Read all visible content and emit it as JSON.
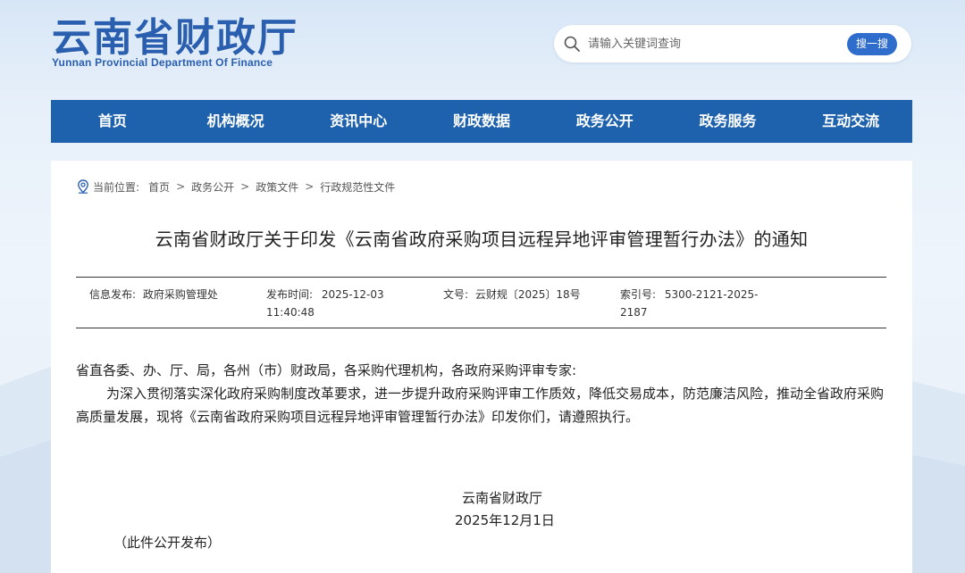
{
  "header": {
    "logo_cn": "云南省财政厅",
    "logo_en": "Yunnan Provincial Department Of Finance"
  },
  "search": {
    "placeholder": "请输入关键词查询",
    "button_label": "搜一搜",
    "icon": "search-icon"
  },
  "nav": {
    "items": [
      {
        "label": "首页"
      },
      {
        "label": "机构概况"
      },
      {
        "label": "资讯中心"
      },
      {
        "label": "财政数据"
      },
      {
        "label": "政务公开"
      },
      {
        "label": "政务服务"
      },
      {
        "label": "互动交流"
      }
    ],
    "color": "#1e62ad"
  },
  "breadcrumb": {
    "label": "当前位置:",
    "items": [
      "首页",
      "政务公开",
      "政策文件",
      "行政规范性文件"
    ],
    "separator": ">"
  },
  "article": {
    "title": "云南省财政厅关于印发《云南省政府采购项目远程异地评审管理暂行办法》的通知",
    "meta": {
      "publisher_label": "信息发布:",
      "publisher": "政府采购管理处",
      "time_label": "发布时间:",
      "time_date": "2025-12-03",
      "time_clock": "11:40:48",
      "doc_no_label": "文号:",
      "doc_no": "云财规〔2025〕18号",
      "index_label": "索引号:",
      "index_line1": "5300-2121-2025-",
      "index_line2": "2187"
    },
    "salutation": "省直各委、办、厅、局，各州（市）财政局，各采购代理机构，各政府采购评审专家:",
    "paragraph": "为深入贯彻落实深化政府采购制度改革要求，进一步提升政府采购评审工作质效，降低交易成本，防范廉洁风险，推动全省政府采购高质量发展，现将《云南省政府采购项目远程异地评审管理暂行办法》印发你们，请遵照执行。",
    "signature_org": "云南省财政厅",
    "signature_date": "2025年12月1日",
    "publish_note": "（此件公开发布）"
  },
  "colors": {
    "brand_blue": "#2a5fb0",
    "button_blue": "#2f6dcc"
  }
}
